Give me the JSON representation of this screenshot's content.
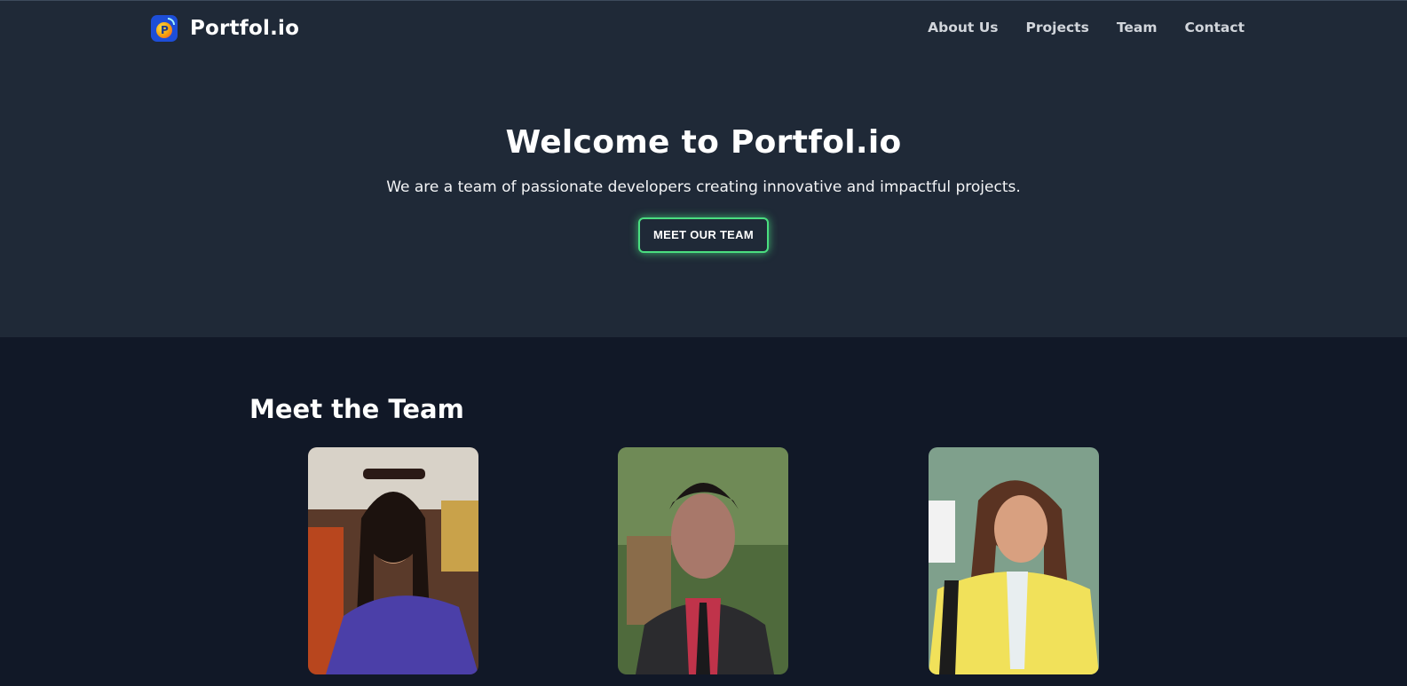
{
  "brand": {
    "name": "Portfol.io",
    "logo_icon": "portfolio-logo-icon"
  },
  "nav": {
    "items": [
      "About Us",
      "Projects",
      "Team",
      "Contact"
    ]
  },
  "hero": {
    "title": "Welcome to Portfol.io",
    "subtitle": "We are a team of passionate developers creating innovative and impactful projects.",
    "cta_label": "MEET OUR TEAM"
  },
  "team": {
    "title": "Meet the Team",
    "photos": [
      "team-member-photo-1",
      "team-member-photo-2",
      "team-member-photo-3"
    ]
  },
  "colors": {
    "hero_bg": "#1f2937",
    "page_bg": "#111827",
    "accent_glow": "#4ade80",
    "nav_text": "#d1d5db"
  }
}
